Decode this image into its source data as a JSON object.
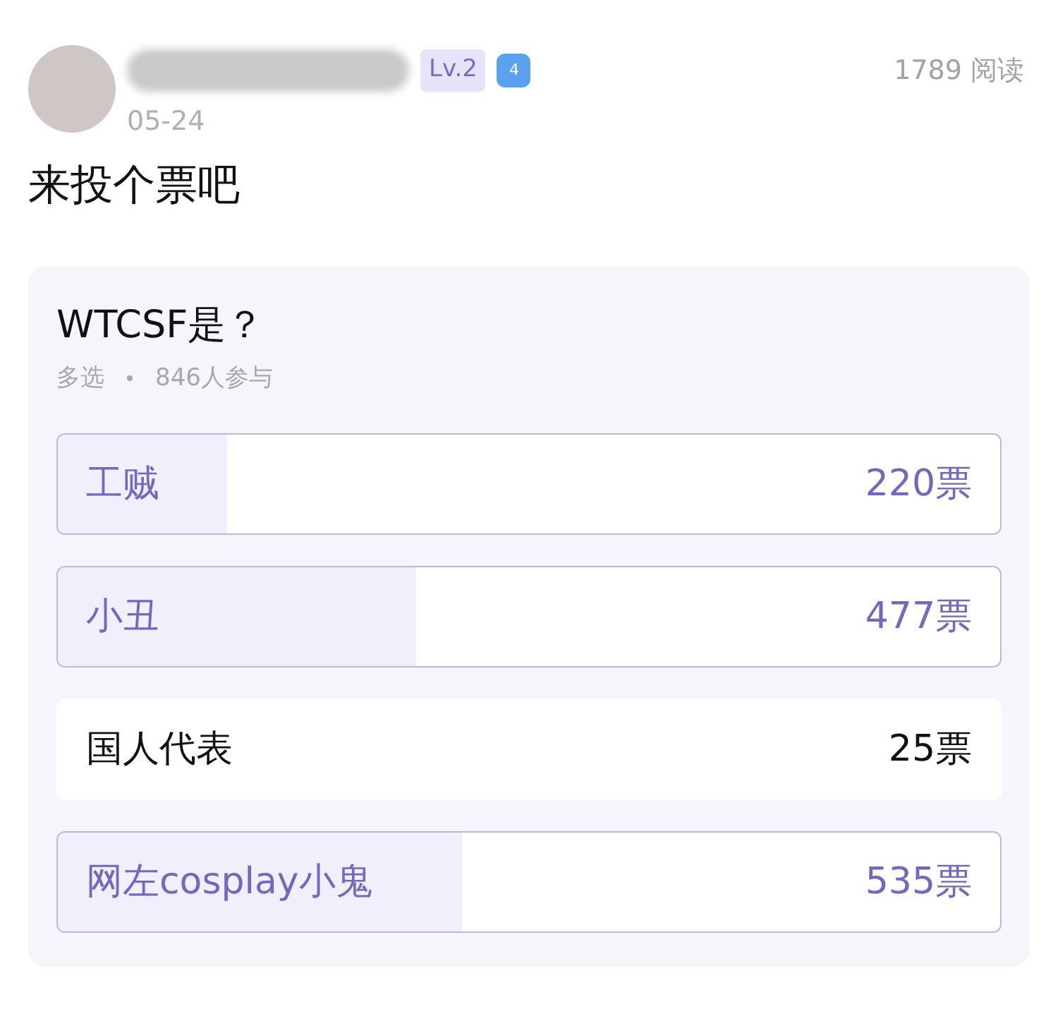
{
  "post": {
    "date": "05-24",
    "level_badge": "Lv.2",
    "rank_badge": "4",
    "views": "1789 阅读",
    "title": "来投个票吧"
  },
  "poll": {
    "question": "WTCSF是？",
    "mode": "多选",
    "participants": "846人参与",
    "options": [
      {
        "label": "工贼",
        "votes": "220票",
        "selected": true,
        "level": 0.18
      },
      {
        "label": "小丑",
        "votes": "477票",
        "selected": true,
        "level": 0.38
      },
      {
        "label": "国人代表",
        "votes": "25票",
        "selected": false
      },
      {
        "label": "网左cosplay小鬼",
        "votes": "535票",
        "selected": true,
        "level": 0.43
      }
    ]
  }
}
